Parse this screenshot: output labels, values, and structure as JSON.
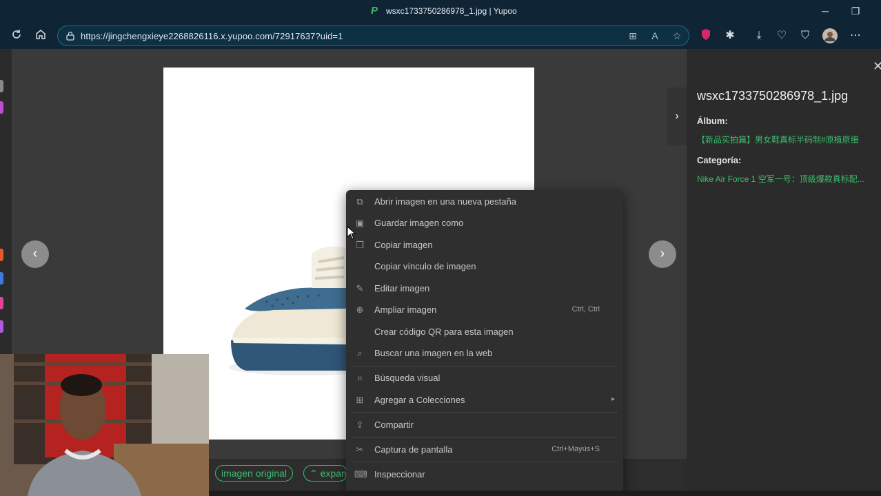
{
  "browser": {
    "tab_title": "wsxc1733750286978_1.jpg | Yupoo",
    "url": "https://jingchengxieye2268826116.x.yupoo.com/72917637?uid=1",
    "window_controls": {
      "minimize": "─",
      "restore": "❐"
    }
  },
  "viewer": {
    "prev_symbol": "‹",
    "next_symbol": "›",
    "buttons": {
      "original": "imagen original",
      "expand": "⌃ expan"
    }
  },
  "panel": {
    "toggle_symbol": "›",
    "close_symbol": "✕",
    "filename": "wsxc1733750286978_1.jpg",
    "album_label": "Álbum:",
    "album_value": "【新品实拍篇】男女鞋真标半码制#原植原细",
    "category_label": "Categoría:",
    "category_value": "Nike Air Force 1 空军一号：顶级爆款真标配..."
  },
  "context_menu": {
    "items": [
      {
        "label": "Abrir imagen en una nueva pestaña",
        "icon": "new-tab-icon",
        "shortcut": ""
      },
      {
        "label": "Guardar imagen como",
        "icon": "save-image-icon",
        "shortcut": ""
      },
      {
        "label": "Copiar imagen",
        "icon": "copy-image-icon",
        "shortcut": ""
      },
      {
        "label": "Copiar vínculo de imagen",
        "icon": "",
        "shortcut": ""
      },
      {
        "label": "Editar imagen",
        "icon": "edit-image-icon",
        "shortcut": ""
      },
      {
        "label": "Ampliar imagen",
        "icon": "zoom-icon",
        "shortcut": "Ctrl, Ctrl"
      },
      {
        "label": "Crear código QR para esta imagen",
        "icon": "",
        "shortcut": ""
      },
      {
        "label": "Buscar una imagen en la web",
        "icon": "image-search-icon",
        "shortcut": ""
      },
      {
        "label": "Búsqueda visual",
        "icon": "visual-search-icon",
        "shortcut": ""
      },
      {
        "label": "Agregar a Colecciones",
        "icon": "collections-icon",
        "shortcut": "",
        "submenu": "▸"
      },
      {
        "label": "Compartir",
        "icon": "share-icon",
        "shortcut": ""
      },
      {
        "label": "Captura de pantalla",
        "icon": "screenshot-icon",
        "shortcut": "Ctrl+Mayús+S"
      },
      {
        "label": "Inspeccionar",
        "icon": "inspect-icon",
        "shortcut": ""
      }
    ]
  },
  "colors": {
    "chrome": "#0f2435",
    "address_border": "#1d6f7d",
    "accent_green": "#3bbd6e",
    "menu_bg": "#2f2f2f"
  }
}
